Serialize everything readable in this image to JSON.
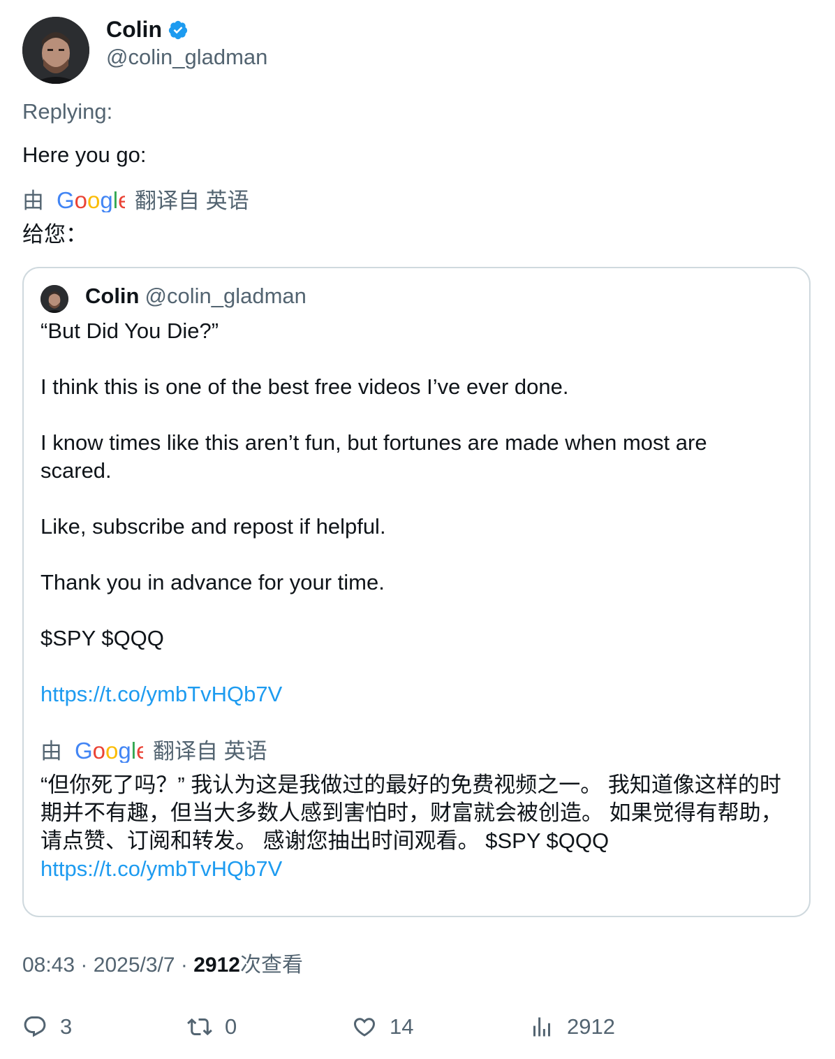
{
  "author": {
    "name": "Colin",
    "handle": "@colin_gladman"
  },
  "reply": {
    "replying_label": "Replying:",
    "text": "Here you go:"
  },
  "translation_bar": {
    "by": "由",
    "brand": "Google",
    "translated_from": "翻译自 英语"
  },
  "reply_translation": "给您：",
  "quote": {
    "name": "Colin",
    "handle": "@colin_gladman",
    "lines": [
      "“But Did You Die?”",
      "I think this is one of the best free videos I’ve ever done.",
      "I know times like this aren’t fun, but fortunes are made when most are scared.",
      "Like, subscribe and repost if helpful.",
      "Thank you in advance for your time.",
      "$SPY $QQQ"
    ],
    "link": "https://t.co/ymbTvHQb7V",
    "translation": "“但你死了吗？” 我认为这是我做过的最好的免费视频之一。 我知道像这样的时期并不有趣，但当大多数人感到害怕时，财富就会被创造。 如果觉得有帮助，请点赞、订阅和转发。 感谢您抽出时间观看。 $SPY $QQQ",
    "translation_link": "https://t.co/ymbTvHQb7V"
  },
  "meta": {
    "time": "08:43",
    "separator": "·",
    "date": "2025/3/7",
    "views_count": "2912",
    "views_label": "次查看"
  },
  "actions": {
    "replies": "3",
    "reposts": "0",
    "likes": "14",
    "views": "2912"
  },
  "colors": {
    "link": "#1d9bf0",
    "verified": "#1d9bf0",
    "muted": "#536471"
  }
}
